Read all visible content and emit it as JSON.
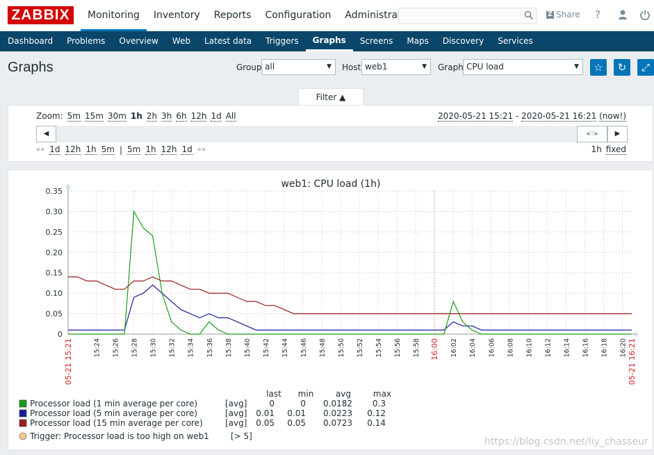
{
  "header": {
    "logo": "ZABBIX",
    "nav": [
      {
        "label": "Monitoring",
        "active": true
      },
      {
        "label": "Inventory",
        "active": false
      },
      {
        "label": "Reports",
        "active": false
      },
      {
        "label": "Configuration",
        "active": false
      },
      {
        "label": "Administration",
        "active": false
      }
    ],
    "search_placeholder": "",
    "share_icon_text": "Z",
    "share_label": "Share",
    "help_icon_text": "?",
    "user_icon_text": "●",
    "logout_icon_text": "⏻",
    "search_icon": "search-icon"
  },
  "subnav": [
    {
      "label": "Dashboard",
      "active": false
    },
    {
      "label": "Problems",
      "active": false
    },
    {
      "label": "Overview",
      "active": false
    },
    {
      "label": "Web",
      "active": false
    },
    {
      "label": "Latest data",
      "active": false
    },
    {
      "label": "Triggers",
      "active": false
    },
    {
      "label": "Graphs",
      "active": true
    },
    {
      "label": "Screens",
      "active": false
    },
    {
      "label": "Maps",
      "active": false
    },
    {
      "label": "Discovery",
      "active": false
    },
    {
      "label": "Services",
      "active": false
    }
  ],
  "page": {
    "title": "Graphs",
    "group_label": "Group",
    "group_value": "all",
    "host_label": "Host",
    "host_value": "web1",
    "graph_label": "Graph",
    "graph_value": "CPU load",
    "favourite_icon": "star-icon",
    "refresh_icon": "refresh-icon",
    "fullscreen_icon": "fullscreen-icon",
    "select_arrow": "▼",
    "favourite_glyph": "☆",
    "refresh_glyph": "↻",
    "fullscreen_glyph": "⤢"
  },
  "filter": {
    "tab_label": "Filter ▲",
    "zoom_label": "Zoom:",
    "zoom_options": [
      "5m",
      "15m",
      "30m",
      "1h",
      "2h",
      "3h",
      "6h",
      "12h",
      "1d",
      "All"
    ],
    "zoom_selected": "1h",
    "period_from": "2020-05-21 15:21",
    "period_sep": " - ",
    "period_to": "2020-05-21 16:21",
    "period_now": "(now!)",
    "back_symbol": "««",
    "back_options": [
      "1d",
      "12h",
      "1h",
      "5m"
    ],
    "separator": "|",
    "forward_options": [
      "5m",
      "1h",
      "12h",
      "1d"
    ],
    "forward_symbol": "»»",
    "period_length": "1h",
    "fixed_label": "fixed",
    "scroll_left_glyph": "◀",
    "scroll_right_glyph": "▶",
    "scroll_handle_glyph": "◂⁝⁝⁝▸"
  },
  "chart_data": {
    "type": "line",
    "title": "web1: CPU load (1h)",
    "ylim": [
      0,
      0.35
    ],
    "y_ticks": [
      "0.35",
      "0.30",
      "0.25",
      "0.20",
      "0.15",
      "0.10",
      "0.05",
      "0"
    ],
    "x_ticks": [
      "15:24",
      "15:26",
      "15:28",
      "15:30",
      "15:32",
      "15:34",
      "15:36",
      "15:38",
      "15:40",
      "15:42",
      "15:44",
      "15:46",
      "15:48",
      "15:50",
      "15:52",
      "15:54",
      "15:56",
      "15:58",
      "16:00",
      "16:02",
      "16:04",
      "16:06",
      "16:08",
      "16:10",
      "16:12",
      "16:14",
      "16:16",
      "16:18",
      "16:20"
    ],
    "x_start_label": "05-21 15:21",
    "x_end_label": "05-21 16:21",
    "x_red_tick": "16:00",
    "grid": true,
    "colors": {
      "s1": "#1a9c1a",
      "s2": "#1c1c9c",
      "s3": "#9c1c1c",
      "grid": "#dcdcdc",
      "axis": "#555555",
      "red": "#d62020",
      "trigger": "#f5c88a"
    },
    "series": [
      {
        "name": "Processor load (1 min average per core)",
        "x": [
          0,
          6,
          7,
          8,
          9,
          10,
          11,
          12,
          13,
          14,
          15,
          16,
          17,
          40,
          41,
          42,
          43,
          44,
          60
        ],
        "values": [
          0,
          0,
          0.3,
          0.26,
          0.24,
          0.1,
          0.03,
          0.01,
          0,
          0,
          0.03,
          0.01,
          0,
          0,
          0.08,
          0.03,
          0.01,
          0,
          0
        ]
      },
      {
        "name": "Processor load (5 min average per core)",
        "x": [
          0,
          6,
          7,
          8,
          9,
          10,
          11,
          12,
          13,
          14,
          15,
          16,
          17,
          18,
          19,
          20,
          40,
          41,
          42,
          43,
          44,
          60
        ],
        "values": [
          0.01,
          0.01,
          0.09,
          0.1,
          0.12,
          0.1,
          0.08,
          0.06,
          0.05,
          0.04,
          0.05,
          0.04,
          0.04,
          0.03,
          0.02,
          0.01,
          0.01,
          0.03,
          0.02,
          0.02,
          0.01,
          0.01
        ]
      },
      {
        "name": "Processor load (15 min average per core)",
        "x": [
          0,
          1,
          2,
          3,
          4,
          5,
          6,
          7,
          8,
          9,
          10,
          11,
          12,
          13,
          14,
          15,
          16,
          17,
          18,
          19,
          20,
          21,
          22,
          23,
          24,
          60
        ],
        "values": [
          0.14,
          0.14,
          0.13,
          0.13,
          0.12,
          0.11,
          0.11,
          0.13,
          0.13,
          0.14,
          0.13,
          0.13,
          0.12,
          0.11,
          0.11,
          0.1,
          0.1,
          0.1,
          0.09,
          0.08,
          0.08,
          0.07,
          0.07,
          0.06,
          0.05,
          0.05
        ]
      }
    ],
    "legend_headers": [
      "last",
      "min",
      "avg",
      "max"
    ],
    "legend": [
      {
        "name": "Processor load (1 min average per core)",
        "func": "[avg]",
        "last": "0",
        "min": "0",
        "avg": "0.0182",
        "max": "0.3"
      },
      {
        "name": "Processor load (5 min average per core)",
        "func": "[avg]",
        "last": "0.01",
        "min": "0.01",
        "avg": "0.0223",
        "max": "0.12"
      },
      {
        "name": "Processor load (15 min average per core)",
        "func": "[avg]",
        "last": "0.05",
        "min": "0.05",
        "avg": "0.0723",
        "max": "0.14"
      }
    ],
    "trigger": {
      "label": "Trigger: Processor load is too high on web1",
      "threshold": "[> 5]"
    }
  },
  "watermark": "https://blog.csdn.net/liy_chasseur"
}
